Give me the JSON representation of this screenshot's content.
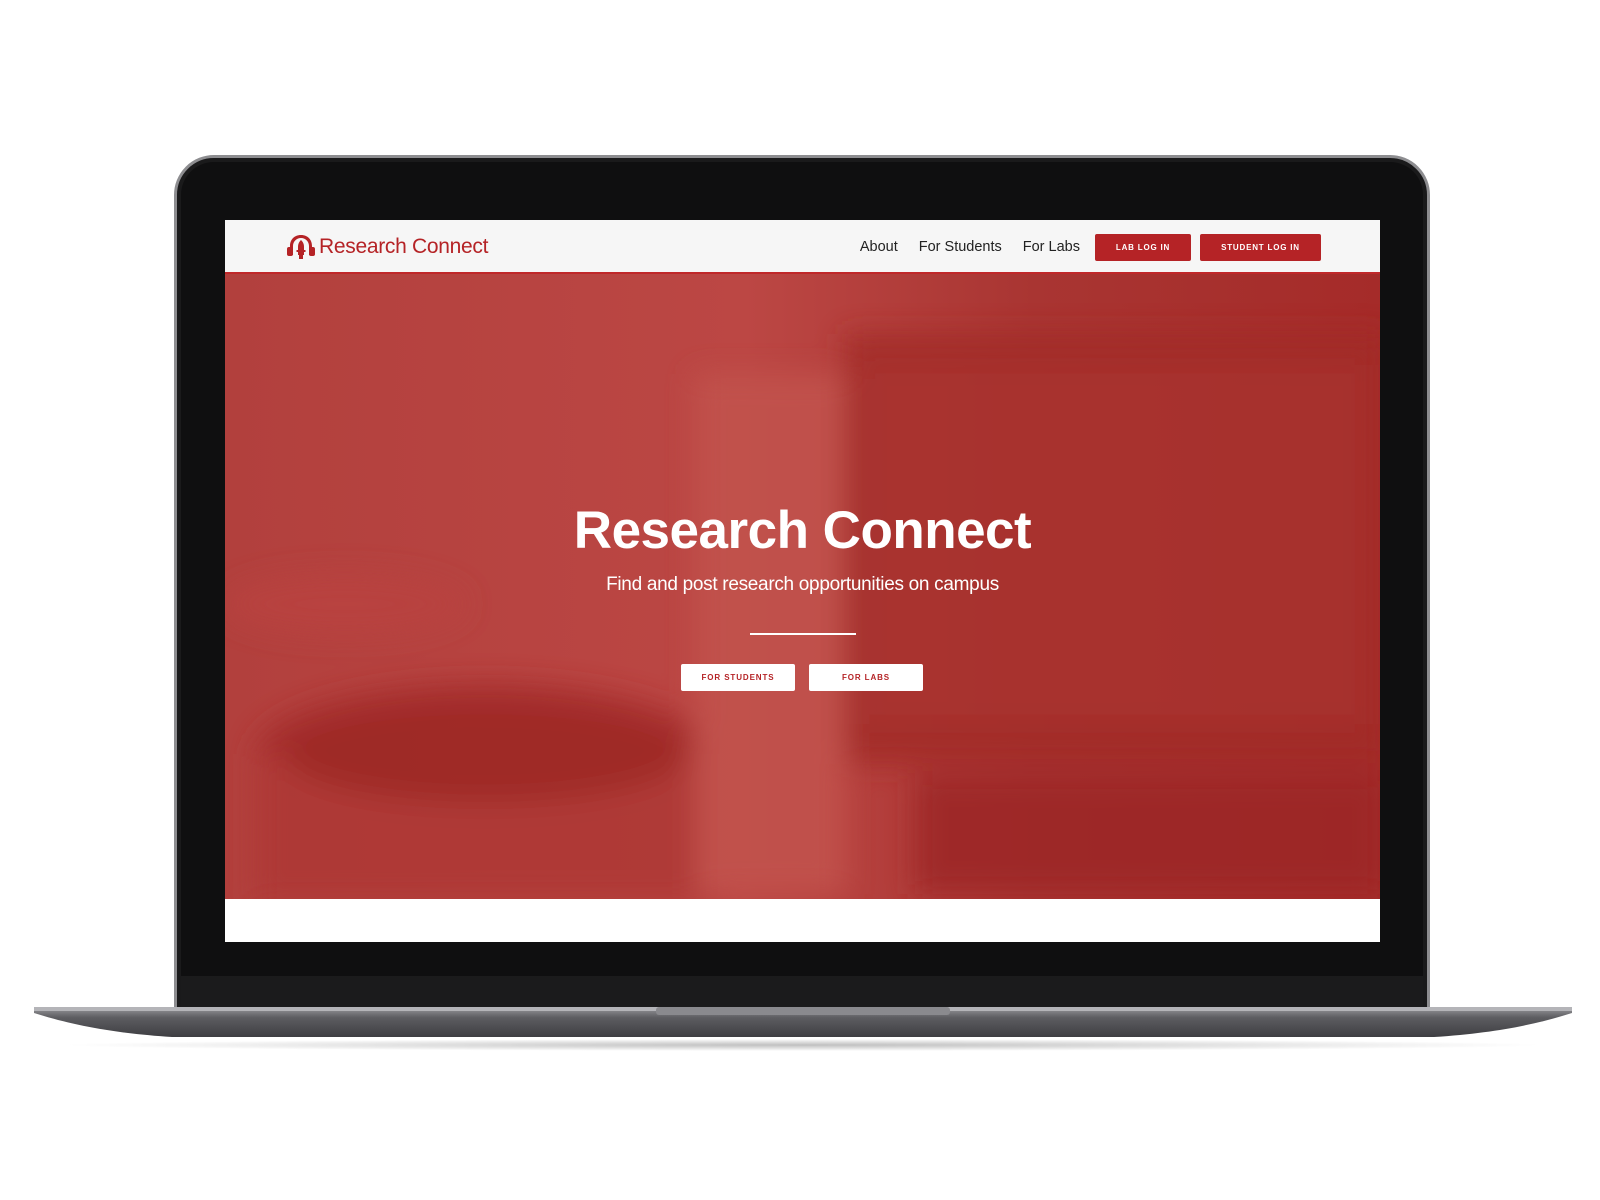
{
  "navbar": {
    "brand": "Research Connect",
    "links": [
      {
        "label": "About"
      },
      {
        "label": "For Students"
      },
      {
        "label": "For Labs"
      }
    ],
    "lab_login_label": "LAB LOG IN",
    "student_login_label": "STUDENT LOG IN"
  },
  "hero": {
    "title": "Research Connect",
    "subtitle": "Find and post research opportunities on campus",
    "for_students_label": "FOR STUDENTS",
    "for_labs_label": "FOR LABS"
  },
  "colors": {
    "brand_red": "#b52326",
    "hero_overlay": "#b03a37",
    "navbar_bg": "#f6f6f6",
    "bezel": "#0f0f10"
  },
  "icons": {
    "brand_logo": "research-connect-logo-icon"
  }
}
